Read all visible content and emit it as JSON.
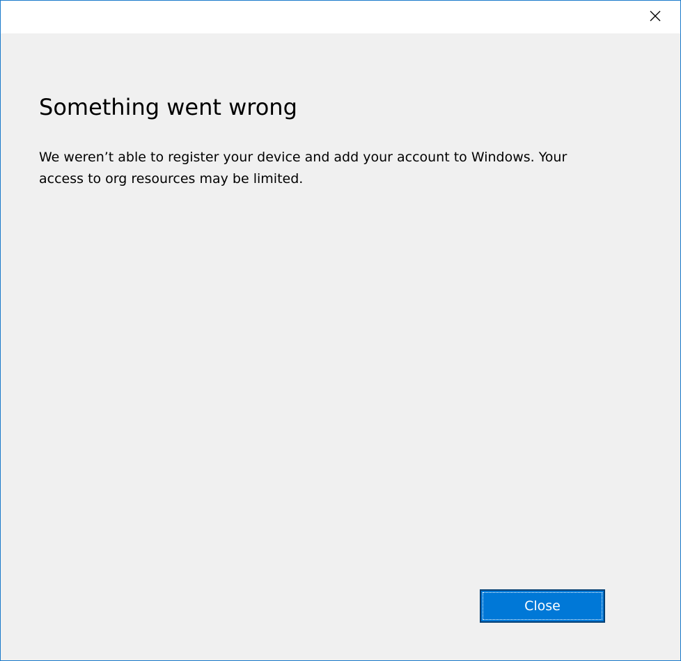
{
  "dialog": {
    "heading": "Something went wrong",
    "message": "We weren’t able to register your device and add your account to Windows. Your access to org resources may be limited."
  },
  "titlebar": {
    "close_icon": "close-icon"
  },
  "footer": {
    "close_label": "Close"
  },
  "colors": {
    "accent": "#0078d7",
    "window_border": "#1979ca",
    "background": "#f0f0f0"
  }
}
